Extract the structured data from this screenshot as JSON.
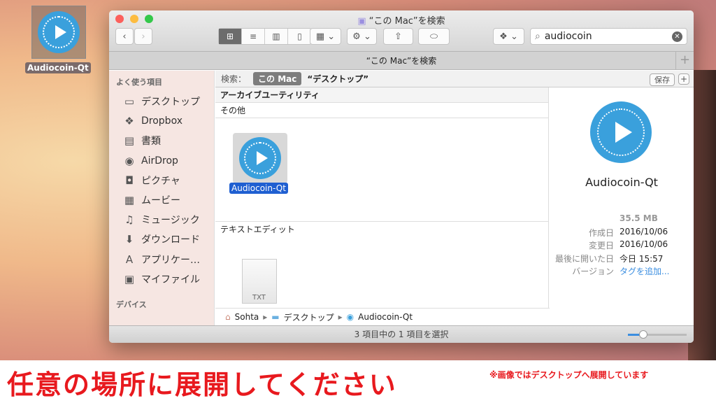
{
  "desktop": {
    "icon_label": "Audiocoin-Qt"
  },
  "window": {
    "title": "“この Mac”を検索",
    "tab_title": "“この Mac”を検索",
    "search_value": "audiocoin",
    "scope": {
      "label": "検索：",
      "this_mac": "この Mac",
      "desktop": "“デスクトップ”",
      "save": "保存",
      "add": "+"
    },
    "sidebar": {
      "favorites_header": "よく使う項目",
      "devices_header": "デバイス",
      "items": [
        {
          "label": "デスクトップ",
          "icon": "▭"
        },
        {
          "label": "Dropbox",
          "icon": "❖"
        },
        {
          "label": "書類",
          "icon": "▤"
        },
        {
          "label": "AirDrop",
          "icon": "◉"
        },
        {
          "label": "ピクチャ",
          "icon": "◘"
        },
        {
          "label": "ムービー",
          "icon": "▦"
        },
        {
          "label": "ミュージック",
          "icon": "♫"
        },
        {
          "label": "ダウンロード",
          "icon": "⬇"
        },
        {
          "label": "アプリケー…",
          "icon": "A"
        },
        {
          "label": "マイファイル",
          "icon": "▣"
        }
      ]
    },
    "groups": [
      {
        "label": "アーカイブユーティリティ"
      },
      {
        "label": "その他",
        "items": [
          "Audiocoin-Qt"
        ]
      },
      {
        "label": "テキストエディット",
        "items": [
          "TXT"
        ]
      }
    ],
    "preview": {
      "name": "Audiocoin-Qt",
      "size": "35.5 MB",
      "rows": [
        {
          "k": "作成日",
          "v": "2016/10/06"
        },
        {
          "k": "変更日",
          "v": "2016/10/06"
        },
        {
          "k": "最後に開いた日",
          "v": "今日 15:57"
        },
        {
          "k": "バージョン",
          "v": "タグを追加..."
        }
      ]
    },
    "path": [
      "Sohta",
      "デスクトップ",
      "Audiocoin-Qt"
    ],
    "status": "3 項目中の 1 項目を選択",
    "icon_size_fraction": 0.2
  },
  "banner": {
    "main": "任意の場所に展開してください",
    "note": "※画像ではデスクトップへ展開しています"
  }
}
